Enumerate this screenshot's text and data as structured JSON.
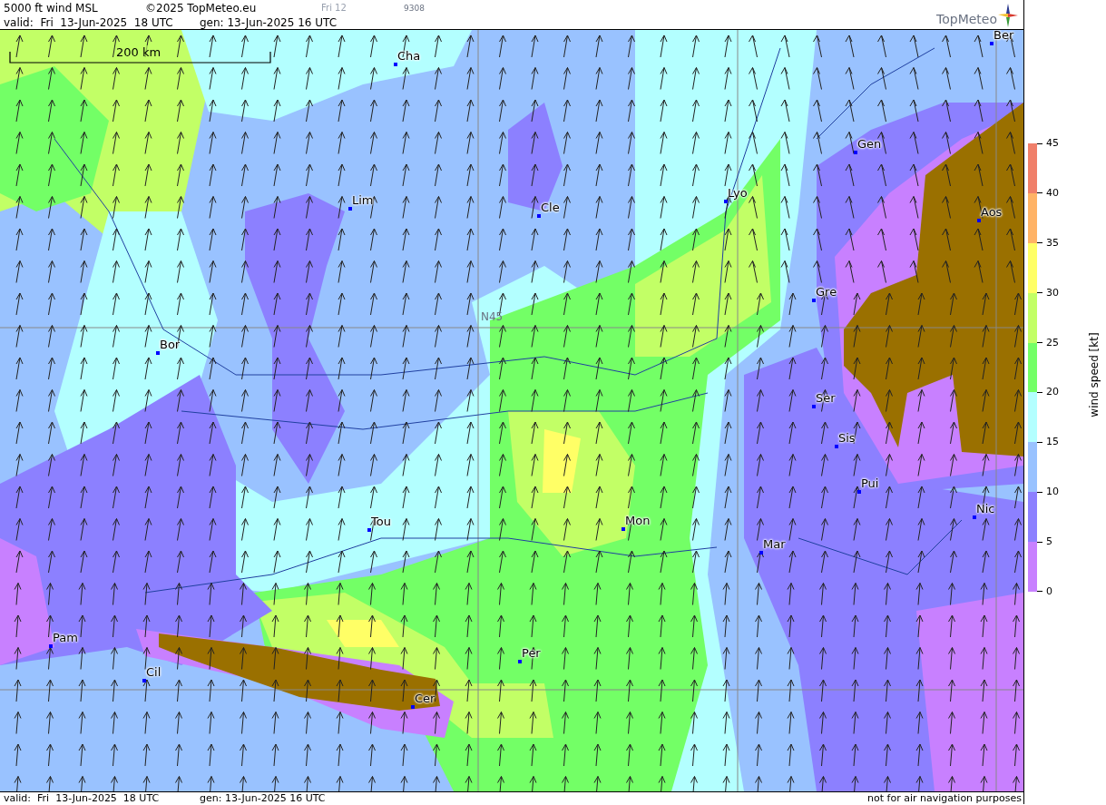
{
  "header": {
    "title": "5000 ft wind MSL",
    "copyright": "©2025 TopMeteo.eu",
    "run_day": "Fri 12",
    "code": "9308",
    "valid": "valid:  Fri  13-Jun-2025  18 UTC",
    "generated": "gen: 13-Jun-2025 16 UTC",
    "logo": "TopMeteo"
  },
  "map": {
    "scale_label": "200 km",
    "grid_label": "N45",
    "cities": [
      {
        "label": "Cha"
      },
      {
        "label": "Ber"
      },
      {
        "label": "Gen"
      },
      {
        "label": "Lim"
      },
      {
        "label": "Cle"
      },
      {
        "label": "Lyo"
      },
      {
        "label": "Aos"
      },
      {
        "label": "Gre"
      },
      {
        "label": "Bor"
      },
      {
        "label": "Ser"
      },
      {
        "label": "Sis"
      },
      {
        "label": "Pui"
      },
      {
        "label": "Tou"
      },
      {
        "label": "Mon"
      },
      {
        "label": "Mar"
      },
      {
        "label": "Nic"
      },
      {
        "label": "Pam"
      },
      {
        "label": "Per"
      },
      {
        "label": "Cil"
      },
      {
        "label": "Cer"
      }
    ]
  },
  "legend": {
    "title": "wind speed [kt]",
    "ticks": [
      "45",
      "40",
      "35",
      "30",
      "25",
      "20",
      "15",
      "10",
      "5",
      "0"
    ],
    "bands": [
      {
        "color": "#f07f6a"
      },
      {
        "color": "#ffb366"
      },
      {
        "color": "#ffff66"
      },
      {
        "color": "#c2ff66"
      },
      {
        "color": "#73ff66"
      },
      {
        "color": "#b3ffff"
      },
      {
        "color": "#99c2ff"
      },
      {
        "color": "#8c80ff"
      },
      {
        "color": "#c880ff"
      }
    ]
  },
  "footer": {
    "valid": "valid:  Fri  13-Jun-2025  18 UTC",
    "generated": "gen: 13-Jun-2025 16 UTC",
    "disclaimer": "not for air navigation purposes"
  }
}
